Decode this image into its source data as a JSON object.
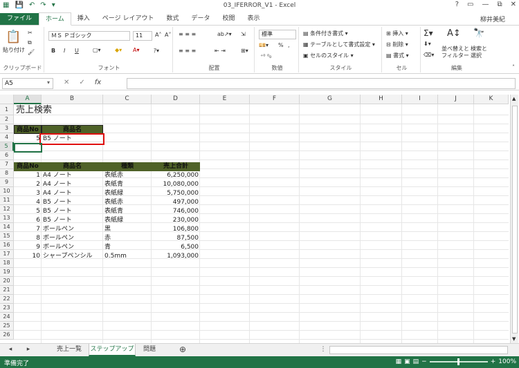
{
  "window": {
    "title": "03_IFERROR_V1 - Excel",
    "user": "柳井美紀",
    "controls": [
      "?",
      "▭",
      "—",
      "⧉",
      "✕"
    ]
  },
  "ribbon_tabs": [
    "ファイル",
    "ホーム",
    "挿入",
    "ページ レイアウト",
    "数式",
    "データ",
    "校閲",
    "表示"
  ],
  "ribbon": {
    "clipboard": {
      "label": "クリップボード",
      "paste": "貼り付け"
    },
    "font": {
      "label": "フォント",
      "name": "ＭＳ Ｐゴシック",
      "size": "11",
      "bold": "B",
      "italic": "I",
      "underline": "U"
    },
    "alignment": {
      "label": "配置"
    },
    "number": {
      "label": "数値",
      "format": "標準",
      "percent": "%",
      "comma": ","
    },
    "styles": {
      "label": "スタイル",
      "cond": "条件付き書式",
      "table": "テーブルとして書式設定",
      "cell": "セルのスタイル"
    },
    "cells": {
      "label": "セル",
      "insert": "挿入",
      "delete": "削除",
      "format": "書式"
    },
    "editing": {
      "label": "編集",
      "sort": "並べ替えと",
      "sort2": "フィルター",
      "find": "検索と",
      "find2": "選択"
    }
  },
  "formula_bar": {
    "name_box": "A5",
    "fx": "fx",
    "content": ""
  },
  "columns": [
    "A",
    "B",
    "C",
    "D",
    "E",
    "F",
    "G",
    "H",
    "I",
    "J",
    "K"
  ],
  "rows": [
    "1",
    "2",
    "3",
    "4",
    "5",
    "6",
    "7",
    "8",
    "9",
    "10",
    "11",
    "12",
    "13",
    "14",
    "15",
    "16",
    "17",
    "18",
    "19",
    "20",
    "21",
    "22",
    "23",
    "24",
    "25",
    "26"
  ],
  "active_cell": "A5",
  "cells": {
    "title": "売上検索",
    "search_header": [
      "商品No",
      "商品名"
    ],
    "search_row": {
      "no": "5",
      "name": "B5 ノート"
    },
    "table_header": [
      "商品No",
      "商品名",
      "種類",
      "売上合計"
    ],
    "table_rows": [
      {
        "no": "1",
        "name": "A4 ノート",
        "type": "表紙赤",
        "total": "6,250,000"
      },
      {
        "no": "2",
        "name": "A4 ノート",
        "type": "表紙青",
        "total": "10,080,000"
      },
      {
        "no": "3",
        "name": "A4 ノート",
        "type": "表紙緑",
        "total": "5,750,000"
      },
      {
        "no": "4",
        "name": "B5 ノート",
        "type": "表紙赤",
        "total": "497,000"
      },
      {
        "no": "5",
        "name": "B5 ノート",
        "type": "表紙青",
        "total": "746,000"
      },
      {
        "no": "6",
        "name": "B5 ノート",
        "type": "表紙緑",
        "total": "230,000"
      },
      {
        "no": "7",
        "name": "ボールペン",
        "type": "黒",
        "total": "106,800"
      },
      {
        "no": "8",
        "name": "ボールペン",
        "type": "赤",
        "total": "87,500"
      },
      {
        "no": "9",
        "name": "ボールペン",
        "type": "青",
        "total": "6,500"
      },
      {
        "no": "10",
        "name": "シャープペンシル",
        "type": "0.5mm",
        "total": "1,093,000"
      }
    ]
  },
  "sheet_tabs": [
    "売上一覧",
    "ステップアップ",
    "問題"
  ],
  "active_sheet": "ステップアップ",
  "status": {
    "ready": "準備完了",
    "zoom": "100%"
  },
  "colors": {
    "accent": "#217346",
    "header_fill": "#4f6228",
    "highlight": "#e01010"
  }
}
